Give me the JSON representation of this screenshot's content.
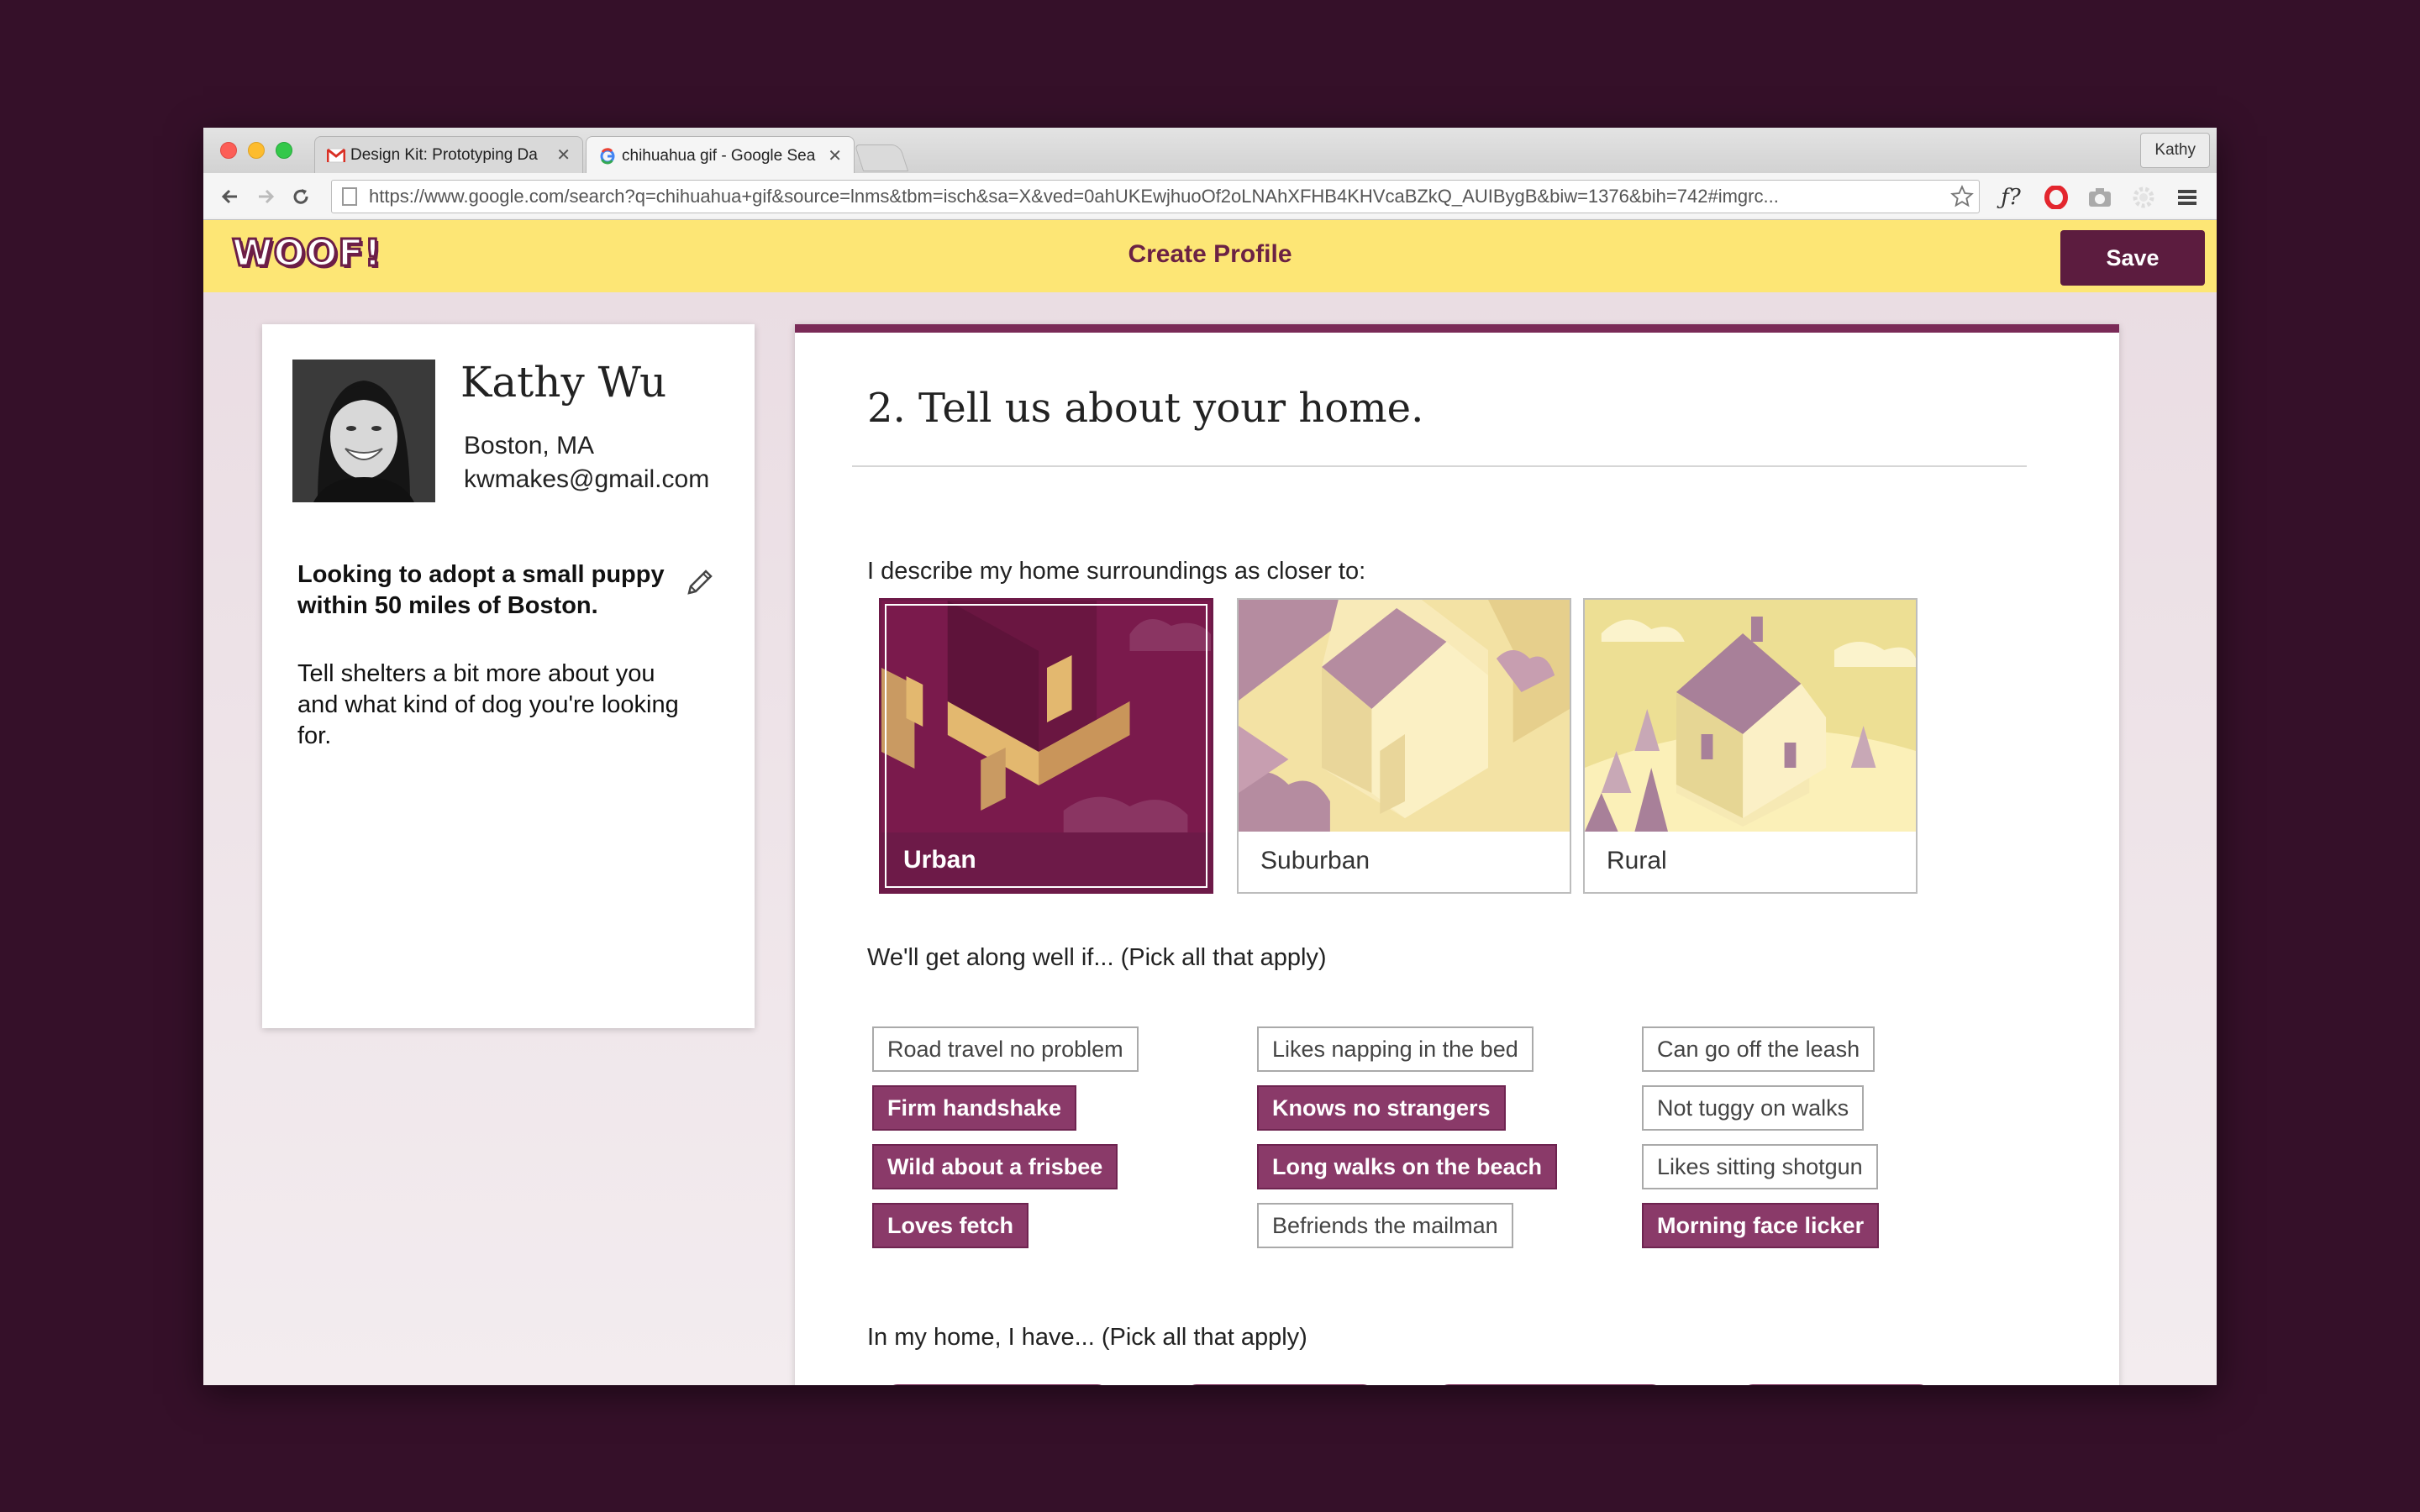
{
  "browser": {
    "tabs": [
      {
        "title": "Design Kit: Prototyping Da",
        "favicon": "gmail-icon",
        "active": false
      },
      {
        "title": "chihuahua gif - Google Sea",
        "favicon": "google-icon",
        "active": true
      }
    ],
    "profile_label": "Kathy",
    "url": "https://www.google.com/search?q=chihuahua+gif&source=lnms&tbm=isch&sa=X&ved=0ahUKEwjhuoOf2oLNAhXFHB4KHVcaBZkQ_AUIBygB&biw=1376&bih=742#imgrc...",
    "extensions": [
      "fx-icon",
      "opera-icon",
      "camera-icon",
      "settings-icon",
      "menu-icon"
    ]
  },
  "app": {
    "logo": "WOOF!",
    "title": "Create Profile",
    "save_label": "Save",
    "colors": {
      "header": "#fde675",
      "primary": "#5c1c3f",
      "chip_on": "#8a3a69"
    }
  },
  "profile": {
    "name": "Kathy Wu",
    "location": "Boston, MA",
    "email": "kwmakes@gmail.com",
    "headline": "Looking to adopt a small puppy within 50 miles of Boston.",
    "body": "Tell shelters a bit more about you and what kind of dog you're looking for."
  },
  "form": {
    "step_title": "2. Tell us about your home.",
    "surroundings_question": "I describe my home surroundings as closer to:",
    "surroundings": [
      {
        "label": "Urban",
        "selected": true
      },
      {
        "label": "Suburban",
        "selected": false
      },
      {
        "label": "Rural",
        "selected": false
      }
    ],
    "traits_question": "We'll get along well if... (Pick all that apply)",
    "traits": [
      {
        "label": "Road travel no problem",
        "selected": false
      },
      {
        "label": "Firm handshake",
        "selected": true
      },
      {
        "label": "Wild about a frisbee",
        "selected": true
      },
      {
        "label": "Loves fetch",
        "selected": true
      },
      {
        "label": "Likes napping in the bed",
        "selected": false
      },
      {
        "label": "Knows no strangers",
        "selected": true
      },
      {
        "label": "Long walks on the beach",
        "selected": true
      },
      {
        "label": "Befriends the mailman",
        "selected": false
      },
      {
        "label": "Can go off the leash",
        "selected": false
      },
      {
        "label": "Not tuggy on walks",
        "selected": false
      },
      {
        "label": "Likes sitting shotgun",
        "selected": false
      },
      {
        "label": "Morning face licker",
        "selected": true
      }
    ],
    "home_question": "In my home, I have... (Pick all that apply)"
  }
}
